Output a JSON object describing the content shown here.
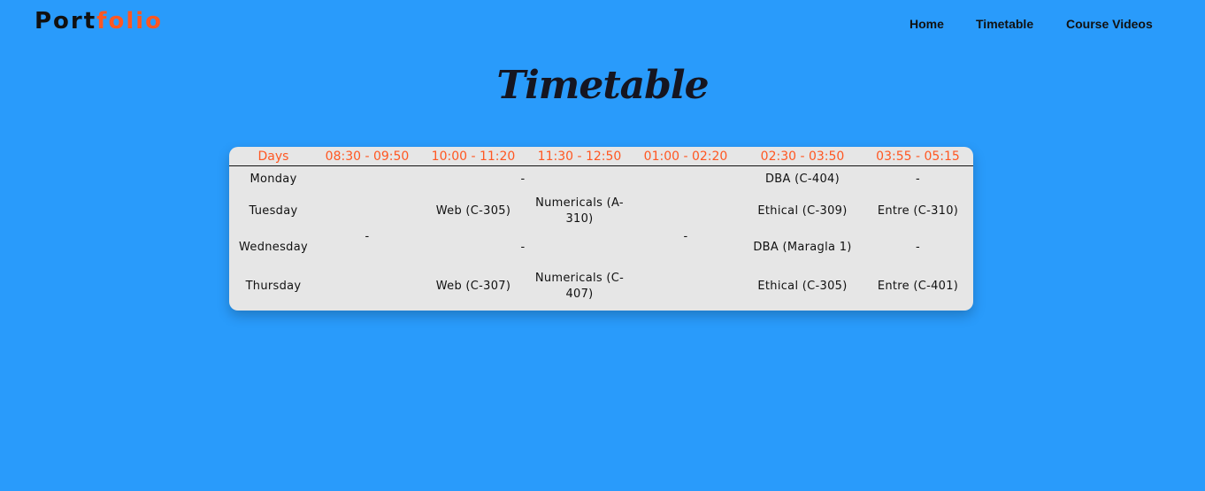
{
  "brand": {
    "logo_part1": "Port",
    "logo_part2": "folio",
    "colors": {
      "background": "#299bfb",
      "accent": "#ff5722",
      "text": "#111111",
      "card": "#e6e6e6"
    }
  },
  "nav": {
    "items": [
      {
        "label": "Home"
      },
      {
        "label": "Timetable"
      },
      {
        "label": "Course Videos"
      }
    ]
  },
  "page": {
    "title": "Timetable"
  },
  "timetable": {
    "headers": [
      "Days",
      "08:30 - 09:50",
      "10:00 - 11:20",
      "11:30 - 12:50",
      "01:00 - 02:20",
      "02:30 - 03:50",
      "03:55 - 05:15"
    ],
    "rows": [
      {
        "day": "Monday",
        "slot_10_11": "-",
        "slot_0230": "DBA (C-404)",
        "slot_0355": "-"
      },
      {
        "day": "Tuesday",
        "slot_1000": "Web (C-305)",
        "slot_1130": "Numericals (A-310)",
        "slot_0230": "Ethical (C-309)",
        "slot_0355": "Entre (C-310)"
      },
      {
        "day": "Wednesday",
        "slot_0830_merged": "-",
        "slot_10_11": "-",
        "slot_0100_merged": "-",
        "slot_0230": "DBA (Maragla 1)",
        "slot_0355": "-"
      },
      {
        "day": "Thursday",
        "slot_1000": "Web (C-307)",
        "slot_1130": "Numericals (C-407)",
        "slot_0230": "Ethical (C-305)",
        "slot_0355": "Entre (C-401)"
      }
    ]
  }
}
